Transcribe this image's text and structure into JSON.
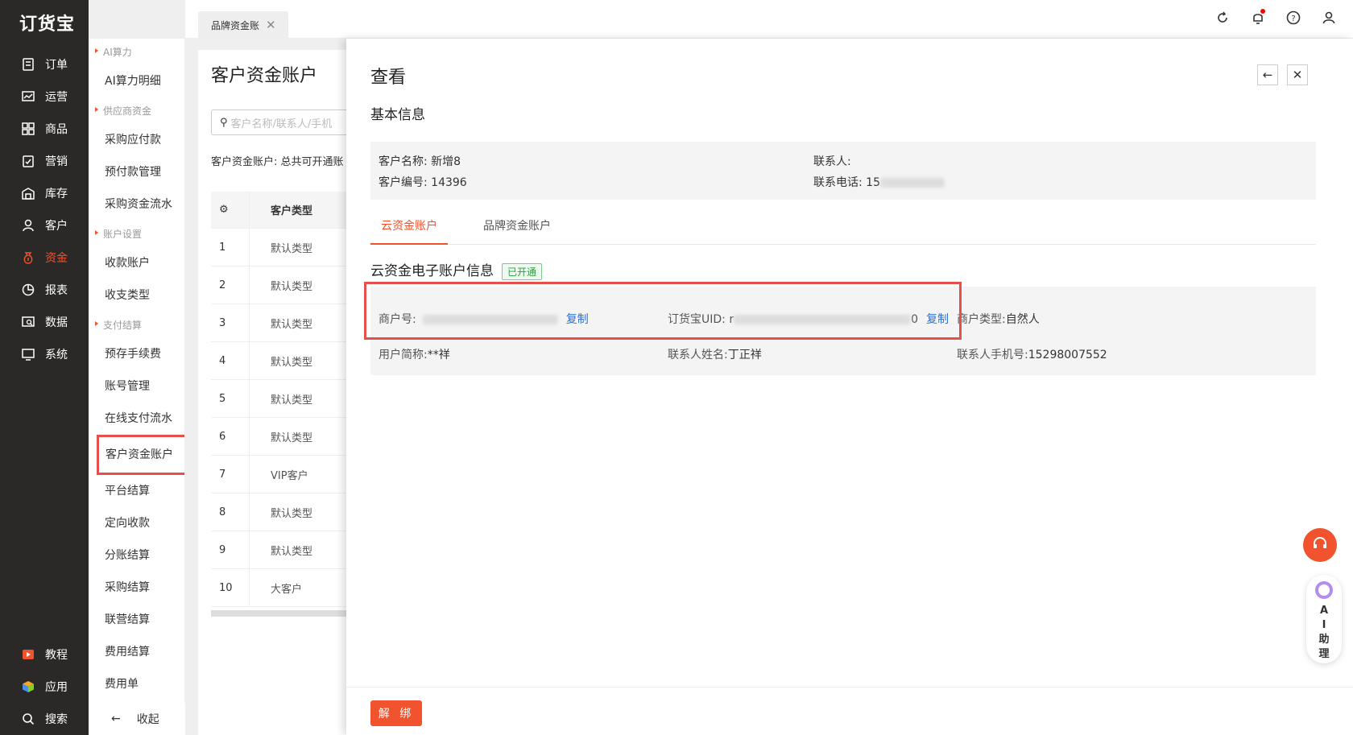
{
  "logo": "订货宝",
  "nav": [
    {
      "label": "订单",
      "icon": "document-icon"
    },
    {
      "label": "运营",
      "icon": "chart-icon"
    },
    {
      "label": "商品",
      "icon": "grid-icon"
    },
    {
      "label": "营销",
      "icon": "clipboard-icon"
    },
    {
      "label": "库存",
      "icon": "warehouse-icon"
    },
    {
      "label": "客户",
      "icon": "user-icon"
    },
    {
      "label": "资金",
      "icon": "money-bag-icon",
      "active": true
    },
    {
      "label": "报表",
      "icon": "pie-icon"
    },
    {
      "label": "数据",
      "icon": "data-icon"
    },
    {
      "label": "系统",
      "icon": "monitor-icon"
    }
  ],
  "nav_bottom": [
    {
      "label": "教程",
      "icon": "video-icon"
    },
    {
      "label": "应用",
      "icon": "cube-icon"
    },
    {
      "label": "搜索",
      "icon": "search-icon"
    }
  ],
  "submenu": {
    "groups": [
      {
        "title": "AI算力",
        "items": [
          "AI算力明细"
        ]
      },
      {
        "title": "供应商资金",
        "items": [
          "采购应付款",
          "预付款管理",
          "采购资金流水"
        ]
      },
      {
        "title": "账户设置",
        "items": [
          "收款账户",
          "收支类型"
        ]
      },
      {
        "title": "支付结算",
        "items": [
          "预存手续费",
          "账号管理",
          "在线支付流水",
          "客户资金账户",
          "平台结算",
          "定向收款",
          "分账结算",
          "采购结算",
          "联营结算",
          "费用结算",
          "费用单"
        ]
      }
    ],
    "collapse": "收起"
  },
  "tab": {
    "label": "品牌资金账"
  },
  "page": {
    "title": "客户资金账户",
    "search_placeholder": "客户名称/联系人/手机",
    "summary": "客户资金账户: 总共可开通账",
    "table_header": "客户类型",
    "rows": [
      {
        "no": "1",
        "type": "默认类型"
      },
      {
        "no": "2",
        "type": "默认类型"
      },
      {
        "no": "3",
        "type": "默认类型"
      },
      {
        "no": "4",
        "type": "默认类型"
      },
      {
        "no": "5",
        "type": "默认类型"
      },
      {
        "no": "6",
        "type": "默认类型"
      },
      {
        "no": "7",
        "type": "VIP客户"
      },
      {
        "no": "8",
        "type": "默认类型"
      },
      {
        "no": "9",
        "type": "默认类型"
      },
      {
        "no": "10",
        "type": "大客户"
      }
    ]
  },
  "drawer": {
    "title": "查看",
    "basic_title": "基本信息",
    "customer_name_label": "客户名称:",
    "customer_name": "新增8",
    "customer_no_label": "客户编号:",
    "customer_no": "14396",
    "contact_label": "联系人:",
    "phone_label": "联系电话:",
    "phone_visible": "15",
    "tabs": [
      "云资金账户",
      "品牌资金账户"
    ],
    "account_title": "云资金电子账户信息",
    "status": "已开通",
    "merchant_no_label": "商户号:",
    "copy": "复制",
    "uid_label": "订货宝UID:",
    "uid_prefix": "r",
    "uid_suffix": "0",
    "merchant_type_label": "商户类型:",
    "merchant_type": "自然人",
    "user_short_label": "用户简称:",
    "user_short": "**祥",
    "contact_name_label": "联系人姓名:",
    "contact_name": "丁正祥",
    "contact_phone_label": "联系人手机号:",
    "contact_phone": "15298007552",
    "unbind": "解 绑"
  },
  "ai_assistant": "AI助理"
}
